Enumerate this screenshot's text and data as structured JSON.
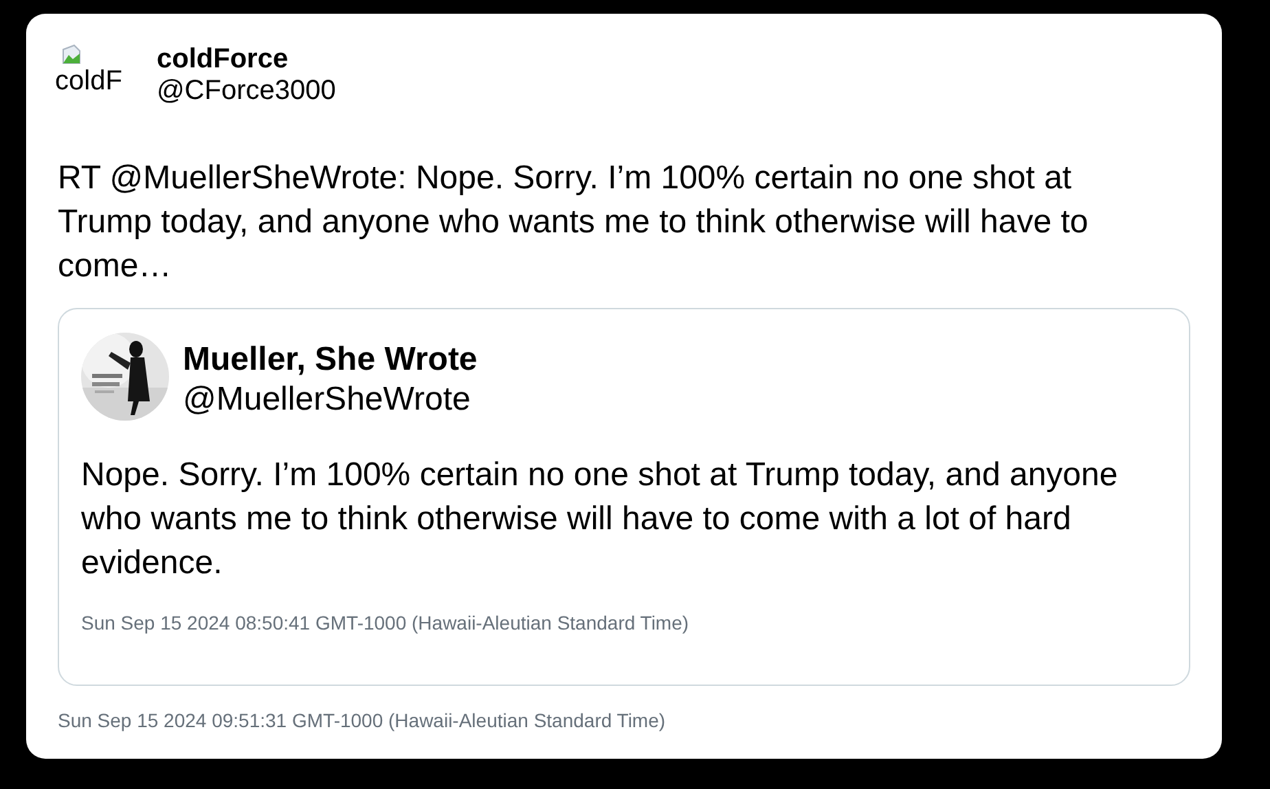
{
  "tweet": {
    "avatar_alt": "coldF",
    "name": "coldForce",
    "handle": "@CForce3000",
    "text": "RT @MuellerSheWrote: Nope. Sorry. I’m 100% certain no one shot at Trump today, and anyone who wants me to think otherwise will have to come…",
    "quoted": {
      "name": "Mueller, She Wrote",
      "handle": "@MuellerSheWrote",
      "text": "Nope. Sorry. I’m 100% certain no one shot at Trump today, and anyone who wants me to think otherwise will have to come with a lot of hard evidence.",
      "timestamp": "Sun Sep 15 2024 08:50:41 GMT-1000 (Hawaii-Aleutian Standard Time)"
    },
    "timestamp": "Sun Sep 15 2024 09:51:31 GMT-1000 (Hawaii-Aleutian Standard Time)"
  }
}
